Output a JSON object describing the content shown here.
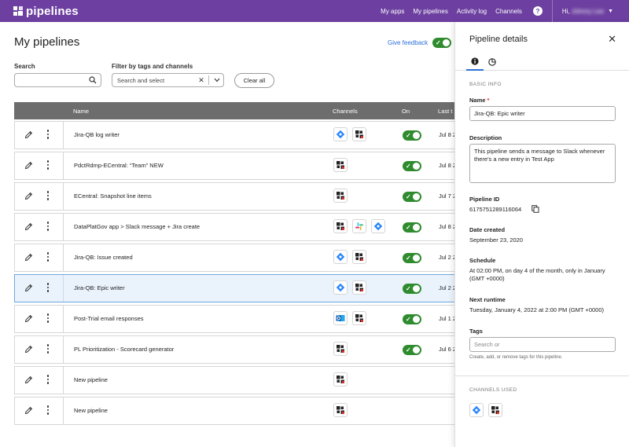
{
  "topbar": {
    "brand": "pipelines",
    "nav": [
      "My apps",
      "My pipelines",
      "Activity log",
      "Channels"
    ],
    "help": "?",
    "user_greeting": "Hi,",
    "user_name": "Johnny Lee"
  },
  "main": {
    "title": "My pipelines",
    "feedback_label": "Give feedback",
    "search": {
      "label": "Search",
      "placeholder": ""
    },
    "filter": {
      "label": "Filter by tags and channels",
      "placeholder": "Search and select"
    },
    "clear_all": "Clear all"
  },
  "table": {
    "columns": [
      "Name",
      "Channels",
      "On",
      "Last t"
    ],
    "rows": [
      {
        "name": "Jira-QB log writer",
        "channels": [
          "jira",
          "qb"
        ],
        "on": true,
        "last": "Jul 8 2",
        "selected": false
      },
      {
        "name": "PdctRdmp-ECentral: “Team” NEW",
        "channels": [
          "qb"
        ],
        "on": true,
        "last": "Jul 8 2",
        "selected": false
      },
      {
        "name": "ECentral: Snapshot line items",
        "channels": [
          "qb"
        ],
        "on": true,
        "last": "Jul 7 2",
        "selected": false
      },
      {
        "name": "DataPlatGov app > Slack message + Jira create",
        "channels": [
          "qb",
          "slack",
          "jira"
        ],
        "on": true,
        "last": "Jul 8 2",
        "selected": false
      },
      {
        "name": "Jira-QB: Issue created",
        "channels": [
          "jira",
          "qb"
        ],
        "on": true,
        "last": "Jul 2 2",
        "selected": false
      },
      {
        "name": "Jira-QB: Epic writer",
        "channels": [
          "jira",
          "qb"
        ],
        "on": true,
        "last": "Jul 2 2",
        "selected": true
      },
      {
        "name": "Post-Trial email responses",
        "channels": [
          "outlook",
          "qb"
        ],
        "on": true,
        "last": "Jul 1 2",
        "selected": false
      },
      {
        "name": "PL Prioritization - Scorecard generator",
        "channels": [
          "qb"
        ],
        "on": true,
        "last": "Jul 6 2",
        "selected": false
      },
      {
        "name": "New pipeline",
        "channels": [
          "qb"
        ],
        "on": false,
        "last": "",
        "selected": false
      },
      {
        "name": "New pipeline",
        "channels": [
          "qb"
        ],
        "on": false,
        "last": "",
        "selected": false
      }
    ]
  },
  "panel": {
    "title": "Pipeline details",
    "section_basic": "BASIC INFO",
    "name_label": "Name",
    "name_required": "*",
    "name_value": "Jira-QB: Epic writer",
    "description_label": "Description",
    "description_value": "This pipeline sends a message to Slack whenever there's a new entry in Test App",
    "pipeline_id_label": "Pipeline ID",
    "pipeline_id_value": "6175751289116064",
    "date_created_label": "Date created",
    "date_created_value": "September 23, 2020",
    "schedule_label": "Schedule",
    "schedule_value": "At 02:00 PM, on day 4 of the month, only in January (GMT +0000)",
    "next_runtime_label": "Next runtime",
    "next_runtime_value": "Tuesday, January 4, 2022 at 2:00 PM (GMT +0000)",
    "tags_label": "Tags",
    "tags_placeholder": "Search or",
    "tags_hint": "Create, add, or remove tags for this pipeline.",
    "channels_used_label": "CHANNELS USED",
    "channels_used": [
      "jira",
      "qb"
    ]
  },
  "colors": {
    "brand": "#6c3fa0",
    "toggle_on": "#2e8b2e",
    "link": "#2b6fd6",
    "jira": "#2684ff",
    "selected_row": "#eaf3fc"
  },
  "icons": {
    "jira": "jira-icon",
    "qb": "quickbase-icon",
    "slack": "slack-icon",
    "outlook": "outlook-icon"
  }
}
